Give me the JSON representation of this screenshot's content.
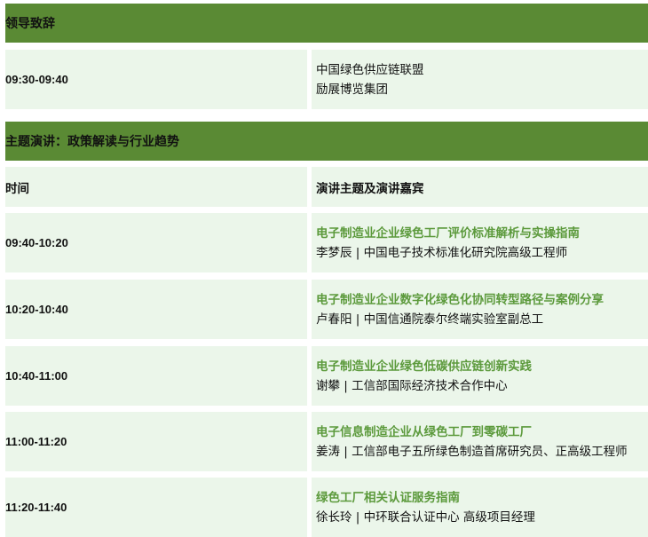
{
  "sections": {
    "leaders": {
      "title": "领导致辞"
    },
    "keynote": {
      "title": "主题演讲：政策解读与行业趋势"
    }
  },
  "leader_row": {
    "time": "09:30-09:40",
    "lines": [
      "中国绿色供应链联盟",
      "励展博览集团"
    ]
  },
  "table_header": {
    "time_label": "时间",
    "topic_label": "演讲主题及演讲嘉宾"
  },
  "talks": [
    {
      "time": "09:40-10:20",
      "title": "电子制造业企业绿色工厂评价标准解析与实操指南",
      "speaker": "李梦辰 | 中国电子技术标准化研究院高级工程师"
    },
    {
      "time": "10:20-10:40",
      "title": "电子制造业企业数字化绿色化协同转型路径与案例分享",
      "speaker": "卢春阳 | 中国信通院泰尔终端实验室副总工"
    },
    {
      "time": "10:40-11:00",
      "title": "电子制造业企业绿色低碳供应链创新实践",
      "speaker": "谢攀 | 工信部国际经济技术合作中心"
    },
    {
      "time": "11:00-11:20",
      "title": "电子信息制造企业从绿色工厂到零碳工厂",
      "speaker": "姜涛 | 工信部电子五所绿色制造首席研究员、正高级工程师"
    },
    {
      "time": "11:20-11:40",
      "title": "绿色工厂相关认证服务指南",
      "speaker": "徐长玲 | 中环联合认证中心  高级项目经理"
    }
  ]
}
